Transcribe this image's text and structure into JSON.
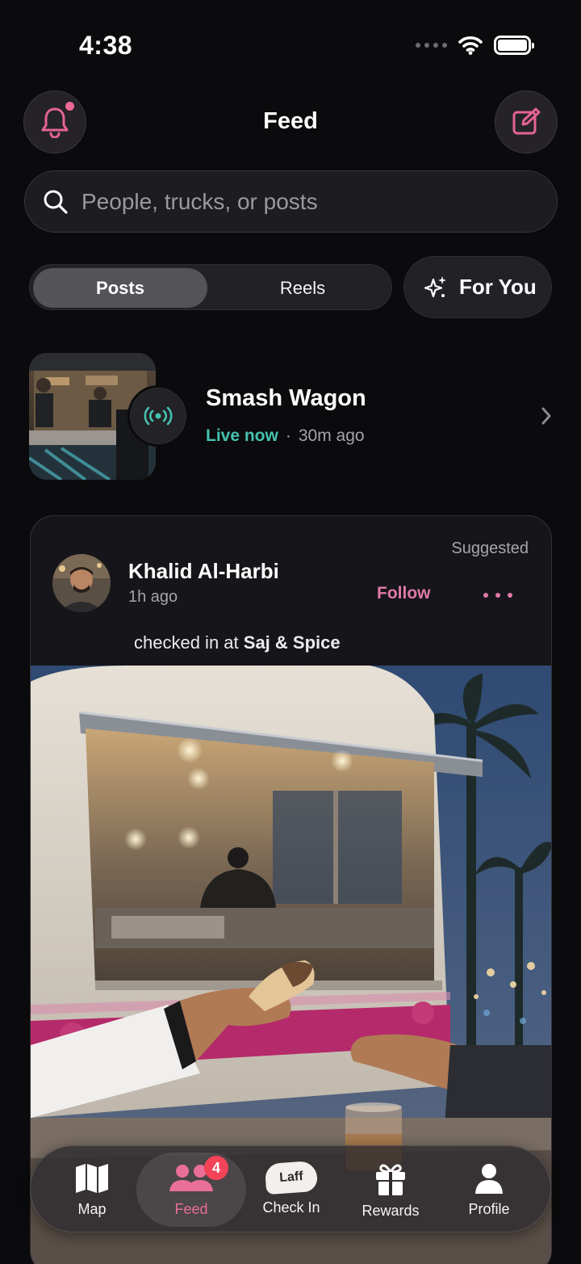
{
  "status_bar": {
    "time": "4:38"
  },
  "header": {
    "title": "Feed"
  },
  "search": {
    "placeholder": "People, trucks, or posts"
  },
  "segments": {
    "posts": "Posts",
    "reels": "Reels",
    "for_you": "For You",
    "selected": "Posts"
  },
  "story": {
    "name": "Smash Wagon",
    "live_label": "Live now",
    "separator": "·",
    "time": "30m ago"
  },
  "post": {
    "suggested_label": "Suggested",
    "user_name": "Khalid Al-Harbi",
    "time": "1h ago",
    "follow_label": "Follow",
    "checkin_prefix": "checked in at",
    "place": "Saj & Spice"
  },
  "tabbar": {
    "items": [
      {
        "label": "Map",
        "icon": "map-icon"
      },
      {
        "label": "Feed",
        "icon": "people-icon",
        "badge": "4",
        "active": true
      },
      {
        "label": "Check In",
        "icon": "laff-logo-icon",
        "logo_text": "Laff"
      },
      {
        "label": "Rewards",
        "icon": "gift-icon"
      },
      {
        "label": "Profile",
        "icon": "person-icon"
      }
    ]
  },
  "colors": {
    "accent_pink": "#e07aa8",
    "live_teal": "#45c2b0",
    "badge_red": "#f24359",
    "background": "#0b0a0c"
  }
}
